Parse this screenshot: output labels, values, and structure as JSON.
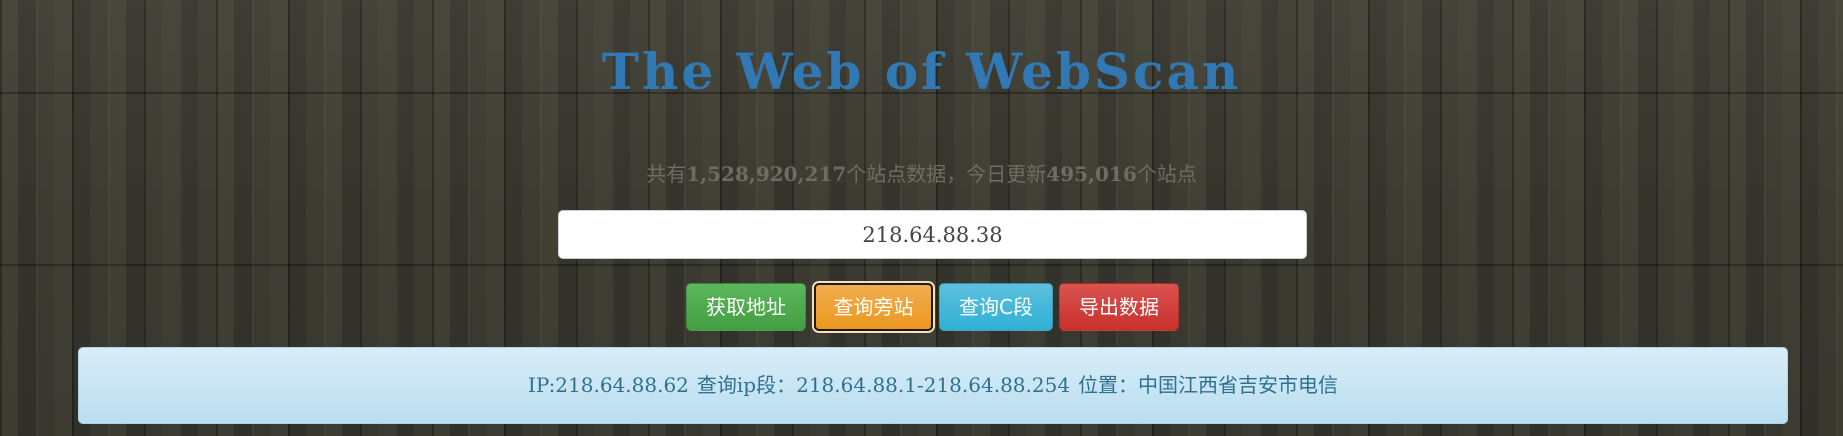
{
  "header": {
    "title": "The Web of WebScan"
  },
  "stats": {
    "prefix": "共有",
    "total_sites": "1,528,920,217",
    "middle": "个站点数据，今日更新",
    "today_updated": "495,016",
    "suffix": "个站点"
  },
  "search": {
    "value": "218.64.88.38",
    "placeholder": ""
  },
  "buttons": {
    "get_address": "获取地址",
    "query_sibling": "查询旁站",
    "query_c_segment": "查询C段",
    "export_data": "导出数据"
  },
  "result": {
    "ip": "IP:218.64.88.62",
    "range": "查询ip段：218.64.88.1-218.64.88.254",
    "location": "位置：中国江西省吉安市电信"
  },
  "colors": {
    "title": "#3179b5",
    "btn_green": "#5cb85c",
    "btn_orange": "#f0ad4e",
    "btn_cyan": "#5bc0de",
    "btn_red": "#d9534f",
    "info_bg": "#d9edf7",
    "info_text": "#31708f"
  }
}
